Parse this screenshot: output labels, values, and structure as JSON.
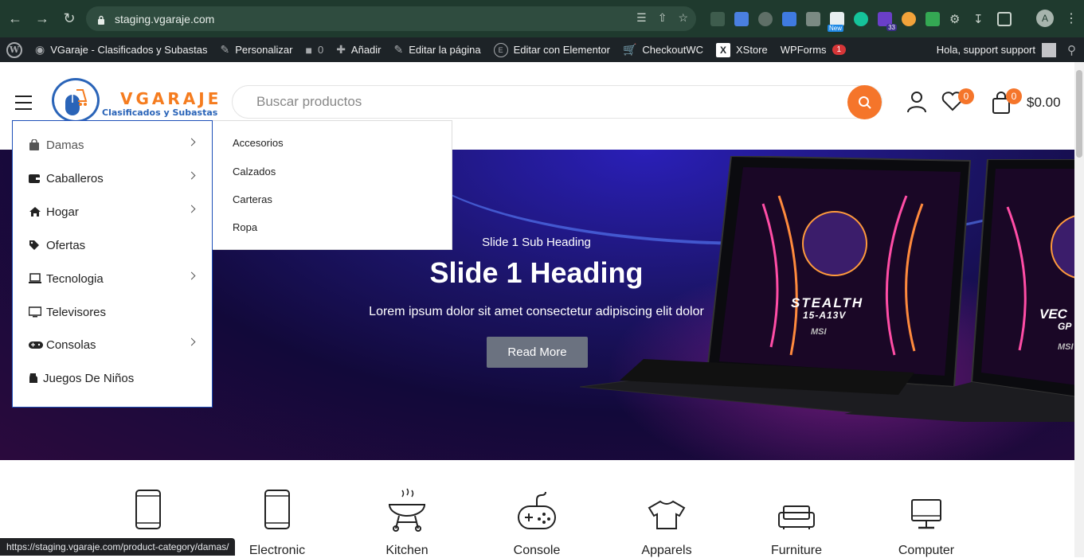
{
  "browser": {
    "url": "staging.vgaraje.com",
    "profile_initial": "A",
    "extension_badge_count": "33",
    "extension_new_label": "New",
    "status_url": "https://staging.vgaraje.com/product-category/damas/"
  },
  "adminbar": {
    "site_name": "VGaraje - Clasificados y Subastas",
    "customize": "Personalizar",
    "comments_count": "0",
    "add_new": "Añadir",
    "edit_page": "Editar la página",
    "edit_elementor": "Editar con Elementor",
    "checkoutwc": "CheckoutWC",
    "xstore": "XStore",
    "wpforms": "WPForms",
    "wpforms_count": "1",
    "greeting": "Hola, support support"
  },
  "header": {
    "logo_title": "VGARAJE",
    "logo_subtitle": "Clasificados y Subastas",
    "search_placeholder": "Buscar productos",
    "wishlist_count": "0",
    "cart_count": "0",
    "cart_total": "$0.00"
  },
  "categories": [
    {
      "label": "Damas",
      "icon": "bag-icon",
      "has_children": true
    },
    {
      "label": "Caballeros",
      "icon": "wallet-icon",
      "has_children": true
    },
    {
      "label": "Hogar",
      "icon": "home-icon",
      "has_children": true
    },
    {
      "label": "Ofertas",
      "icon": "tag-icon",
      "has_children": false
    },
    {
      "label": "Tecnologia",
      "icon": "laptop-icon",
      "has_children": true
    },
    {
      "label": "Televisores",
      "icon": "tv-icon",
      "has_children": false
    },
    {
      "label": "Consolas",
      "icon": "gamepad-icon",
      "has_children": true
    },
    {
      "label": "Juegos De Niños",
      "icon": "toy-icon",
      "has_children": false
    }
  ],
  "submenu": [
    "Accesorios",
    "Calzados",
    "Carteras",
    "Ropa"
  ],
  "hero": {
    "sub_heading": "Slide 1 Sub Heading",
    "heading": "Slide 1 Heading",
    "text": "Lorem ipsum dolor sit amet consectetur adipiscing elit dolor",
    "button": "Read More",
    "laptop1_brand": "STEALTH",
    "laptop1_model": "15-A13V",
    "laptop_logo": "MSI",
    "laptop2_brand": "VEC",
    "laptop2_model": "GP"
  },
  "strip": [
    {
      "label": "",
      "icon": "phone-icon"
    },
    {
      "label": "Electronic",
      "icon": "tablet-icon"
    },
    {
      "label": "Kitchen",
      "icon": "grill-icon"
    },
    {
      "label": "Console",
      "icon": "gamepad-icon"
    },
    {
      "label": "Apparels",
      "icon": "tshirt-icon"
    },
    {
      "label": "Furniture",
      "icon": "sofa-icon"
    },
    {
      "label": "Computer",
      "icon": "monitor-icon"
    }
  ],
  "colors": {
    "accent": "#f5752a",
    "brand_blue": "#2a64b8",
    "adminbar": "#1d2327",
    "chrome": "#1f3a2e"
  }
}
